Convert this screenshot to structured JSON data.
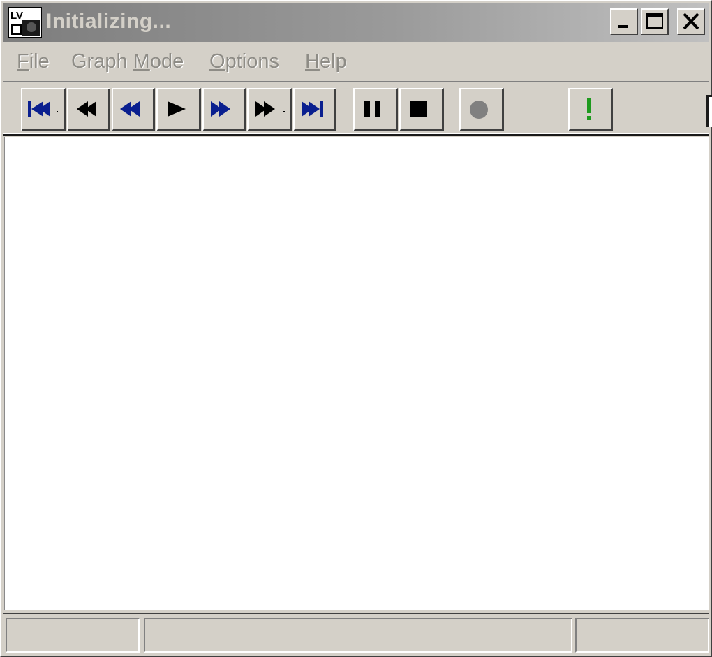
{
  "window": {
    "title": "Initializing...",
    "app_icon": "labview-app-icon",
    "caption_buttons": [
      "minimize-icon",
      "maximize-icon",
      "close-icon"
    ]
  },
  "menu": {
    "items": [
      {
        "label_pre": "",
        "hotkey": "F",
        "label_post": "ile"
      },
      {
        "label_pre": "Graph ",
        "hotkey": "M",
        "label_post": "ode"
      },
      {
        "label_pre": "",
        "hotkey": "O",
        "label_post": "ptions"
      },
      {
        "label_pre": "",
        "hotkey": "H",
        "label_post": "elp"
      }
    ]
  },
  "toolbar": {
    "buttons": [
      {
        "icon": "skip-to-start-icon",
        "color": "#0a1f8f"
      },
      {
        "icon": "rewind-icon",
        "color": "#000000"
      },
      {
        "icon": "step-back-icon",
        "color": "#0a1f8f"
      },
      {
        "icon": "play-icon",
        "color": "#000000"
      },
      {
        "icon": "step-forward-icon",
        "color": "#0a1f8f"
      },
      {
        "icon": "fast-forward-icon",
        "color": "#000000"
      },
      {
        "icon": "skip-to-end-icon",
        "color": "#0a1f8f"
      },
      {
        "icon": "pause-icon",
        "color": "#000000"
      },
      {
        "icon": "stop-icon",
        "color": "#000000"
      },
      {
        "icon": "record-icon",
        "color": "#808080"
      },
      {
        "icon": "alert-icon",
        "color": "#1e9a1e"
      }
    ]
  },
  "statusbar": {
    "panes": [
      "",
      "",
      ""
    ]
  }
}
